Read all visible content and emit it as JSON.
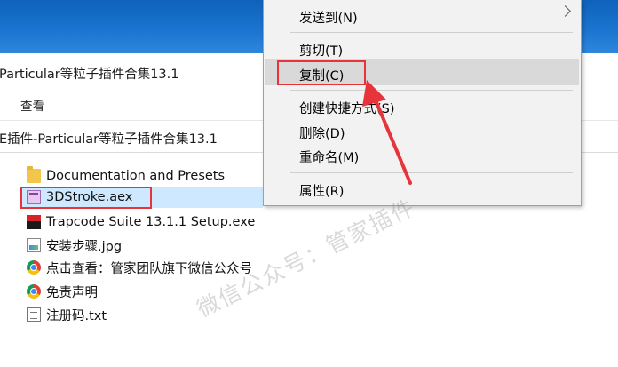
{
  "window": {
    "title": "Particular等粒子插件合集13.1",
    "ribbon_tab": "查看",
    "address": "E插件-Particular等粒子插件合集13.1"
  },
  "files": [
    {
      "name": "Documentation and Presets",
      "icon": "folder-icon",
      "selected": false
    },
    {
      "name": "3DStroke.aex",
      "icon": "plugin-file-icon",
      "selected": true
    },
    {
      "name": "Trapcode Suite 13.1.1 Setup.exe",
      "icon": "installer-icon",
      "selected": false
    },
    {
      "name": "安装步骤.jpg",
      "icon": "image-file-icon",
      "selected": false
    },
    {
      "name": "点击查看：管家团队旗下微信公众号",
      "icon": "chrome-shortcut-icon",
      "selected": false
    },
    {
      "name": "免责声明",
      "icon": "chrome-shortcut-icon",
      "selected": false
    },
    {
      "name": "注册码.txt",
      "icon": "text-file-icon",
      "selected": false
    }
  ],
  "context_menu": {
    "items": [
      {
        "label": "发送到(N)",
        "submenu": true
      },
      {
        "label": "剪切(T)"
      },
      {
        "label": "复制(C)",
        "highlighted": true
      },
      {
        "label": "创建快捷方式(S)"
      },
      {
        "label": "删除(D)"
      },
      {
        "label": "重命名(M)"
      },
      {
        "label": "属性(R)"
      }
    ]
  },
  "annotations": {
    "highlight_color": "#e6343a",
    "watermark": "微信公众号：管家插件"
  },
  "colors": {
    "desktop_blue": "#1a74cf",
    "selection": "#cde8ff",
    "menu_bg": "#f2f2f2"
  }
}
